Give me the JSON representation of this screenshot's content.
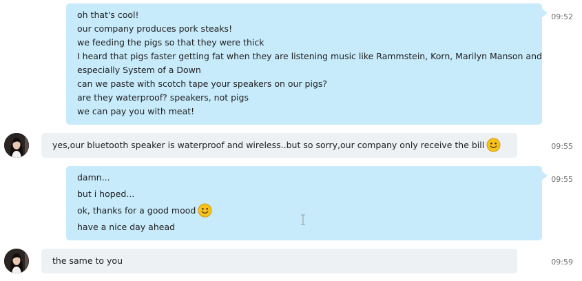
{
  "messages": [
    {
      "direction": "outgoing",
      "time": "09:52",
      "lines": [
        "oh that's cool!",
        "our company produces pork steaks!",
        "we feeding the pigs so that they were thick",
        "I heard that pigs faster getting fat when they are listening music like Rammstein, Korn, Marilyn Manson and",
        "especially System of a Down",
        "can we paste with scotch tape your speakers on our pigs?",
        "are they waterproof? speakers, not pigs",
        "we can pay you with meat!"
      ]
    },
    {
      "direction": "incoming",
      "time": "09:55",
      "lines": [
        "yes,our bluetooth speaker is waterproof and wireless..but so sorry,our company only receive the bill"
      ],
      "emoji": "smiley-emoji"
    },
    {
      "direction": "outgoing",
      "time": "09:55",
      "lines": [
        "damn...",
        "but i hoped...",
        "ok, thanks for a good mood",
        "have a nice day ahead"
      ],
      "emoji": "smiley-emoji"
    },
    {
      "direction": "incoming",
      "time": "09:59",
      "lines": [
        "the same to you"
      ]
    }
  ],
  "colors": {
    "outgoing_bubble": "#c7ebfb",
    "incoming_bubble": "#eef1f4",
    "timestamp": "#6e6e6e",
    "emoji": "#f7c21c"
  },
  "icons": {
    "cursor": "text-cursor-icon",
    "avatar": "contact-avatar"
  }
}
